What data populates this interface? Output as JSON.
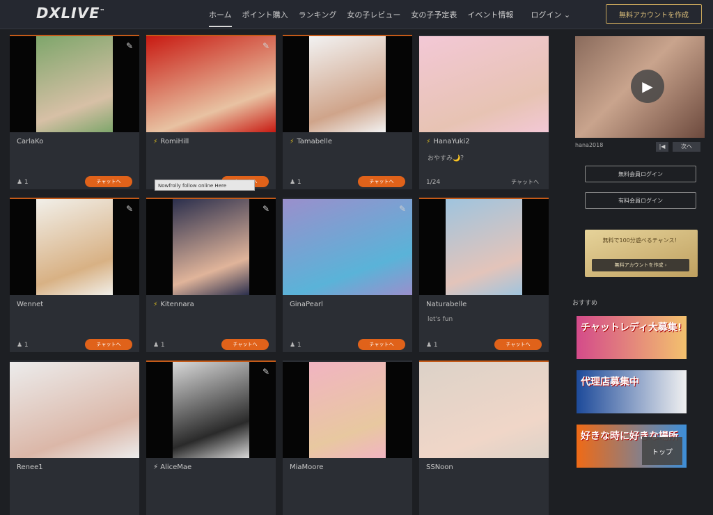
{
  "header": {
    "logo": "DXLIVE",
    "logo_mark": "™",
    "nav": [
      "ホーム",
      "ポイント購入",
      "ランキング",
      "女の子レビュー",
      "女の子予定表",
      "イベント情報"
    ],
    "login": "ログイン ⌄",
    "signup": "無料アカウントを作成"
  },
  "cards": [
    {
      "name": "CarlaKo",
      "bolt": false,
      "desc": "",
      "viewers": "1",
      "button": "チャットへ",
      "thumb": [
        "#7ea66b",
        "#d7c0a6"
      ],
      "pencil": true,
      "bar": true
    },
    {
      "name": "RomiHill",
      "bolt": true,
      "desc": "",
      "viewers": "",
      "button": "チャットへ",
      "thumb": [
        "#c81a12",
        "#e8c2a2"
      ],
      "pencil": true,
      "bar": true
    },
    {
      "name": "Tamabelle",
      "bolt": true,
      "desc": "",
      "viewers": "1",
      "button": "チャットへ",
      "thumb": [
        "#f2f2f2",
        "#cfa48a"
      ],
      "pencil": false,
      "bar": true
    },
    {
      "name": "HanaYuki2",
      "bolt": true,
      "desc": "おやすみ🌙？",
      "viewers": "1/24",
      "button": "チャットへ",
      "thumb": [
        "#f3c8d6",
        "#e7c3b3"
      ],
      "pencil": false,
      "bar": false,
      "link": true
    },
    {
      "name": "Wennet",
      "bolt": false,
      "desc": "",
      "viewers": "1",
      "button": "チャットへ",
      "thumb": [
        "#f1efe9",
        "#d8b184"
      ],
      "pencil": true,
      "bar": true
    },
    {
      "name": "Kitennara",
      "bolt": true,
      "desc": "",
      "viewers": "1",
      "button": "チャットへ",
      "thumb": [
        "#2b2f4d",
        "#e0b49a"
      ],
      "pencil": true,
      "bar": true
    },
    {
      "name": "GinaPearl",
      "bolt": false,
      "desc": "",
      "viewers": "1",
      "button": "チャットへ",
      "thumb": [
        "#9a8fcc",
        "#5ab3d8"
      ],
      "pencil": true,
      "bar": false
    },
    {
      "name": "Naturabelle",
      "bolt": false,
      "desc": "let's fun",
      "viewers": "1",
      "button": "チャットへ",
      "thumb": [
        "#9fc4de",
        "#e3c4ba"
      ],
      "pencil": false,
      "bar": true
    },
    {
      "name": "Renee1",
      "bolt": false,
      "desc": "",
      "viewers": "",
      "button": "",
      "thumb": [
        "#ececec",
        "#dbb7a8"
      ],
      "pencil": false,
      "bar": false
    },
    {
      "name": "AliceMae",
      "bolt": true,
      "desc": "",
      "viewers": "",
      "button": "",
      "thumb": [
        "#d8d8d8",
        "#2a2a2a"
      ],
      "pencil": true,
      "bar": true
    },
    {
      "name": "MiaMoore",
      "bolt": false,
      "desc": "",
      "viewers": "",
      "button": "",
      "thumb": [
        "#f1b4c2",
        "#e8c8a0"
      ],
      "pencil": false,
      "bar": false
    },
    {
      "name": "SSNoon",
      "bolt": false,
      "desc": "",
      "viewers": "",
      "button": "",
      "thumb": [
        "#dcd2c8",
        "#f0d6c8"
      ],
      "pencil": false,
      "bar": true
    }
  ],
  "tooltip": "Nowfrolly follow online Here",
  "sidebar": {
    "video_caption": "hana2018",
    "video_mini1": "|◀",
    "video_mini2": "次へ",
    "btn1": "無料会員ログイン",
    "btn2": "有料会員ログイン",
    "promo_text": "無料で100分遊べるチャンス！",
    "promo_button": "無料アカウントを作成 ›",
    "section_title": "おすすめ",
    "banners": [
      {
        "text": "チャットレディ大募集!",
        "colors": [
          "#d44b8a",
          "#f3c16e"
        ]
      },
      {
        "text": "代理店募集中",
        "colors": [
          "#1d4a9a",
          "#f0f0f0"
        ]
      },
      {
        "text": "好きな時に好きな場所",
        "colors": [
          "#ef6a16",
          "#3d8ed8"
        ]
      }
    ]
  },
  "top_button": "トップ"
}
